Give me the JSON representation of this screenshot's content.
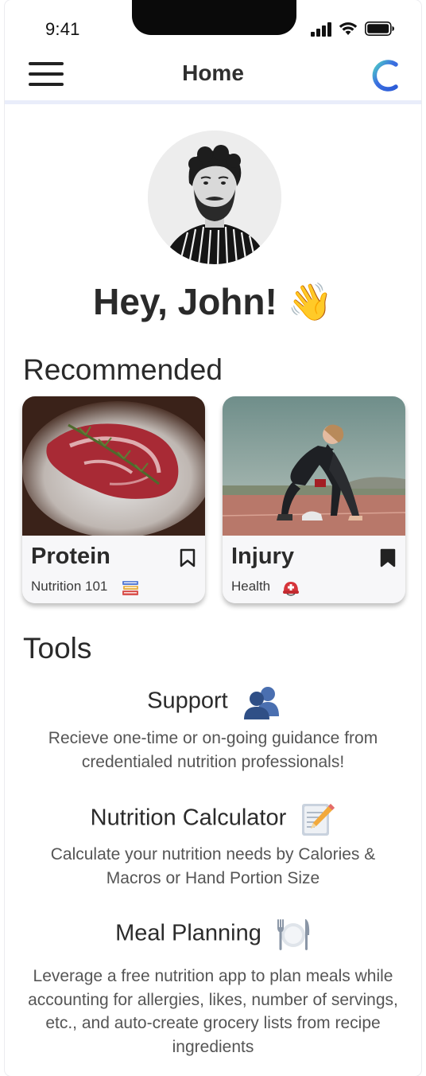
{
  "status_bar": {
    "time": "9:41"
  },
  "header": {
    "title": "Home",
    "menu_icon": "hamburger-menu-icon",
    "logo_icon": "app-logo-c-icon",
    "accent_color": "#3b6fe0"
  },
  "profile": {
    "greeting": "Hey, John!",
    "wave_emoji": "👋"
  },
  "recommended": {
    "heading": "Recommended",
    "cards": [
      {
        "title": "Protein",
        "subtitle": "Nutrition 101",
        "subtitle_icon": "books-icon",
        "bookmarked": false
      },
      {
        "title": "Injury",
        "subtitle": "Health",
        "subtitle_icon": "rescue-helmet-icon",
        "bookmarked": true
      }
    ]
  },
  "tools": {
    "heading": "Tools",
    "items": [
      {
        "title": "Support",
        "icon": "people-silhouette-icon",
        "description": "Recieve one-time or on-going guidance from credentialed nutrition professionals!"
      },
      {
        "title": "Nutrition Calculator",
        "icon": "memo-pencil-icon",
        "description": "Calculate your nutrition needs by Calories & Macros or Hand Portion Size"
      },
      {
        "title": "Meal Planning",
        "icon": "fork-knife-plate-icon",
        "description": "Leverage a free nutrition app to plan meals while accounting for allergies, likes, number of servings, etc., and auto-create grocery lists from recipe ingredients"
      }
    ]
  }
}
